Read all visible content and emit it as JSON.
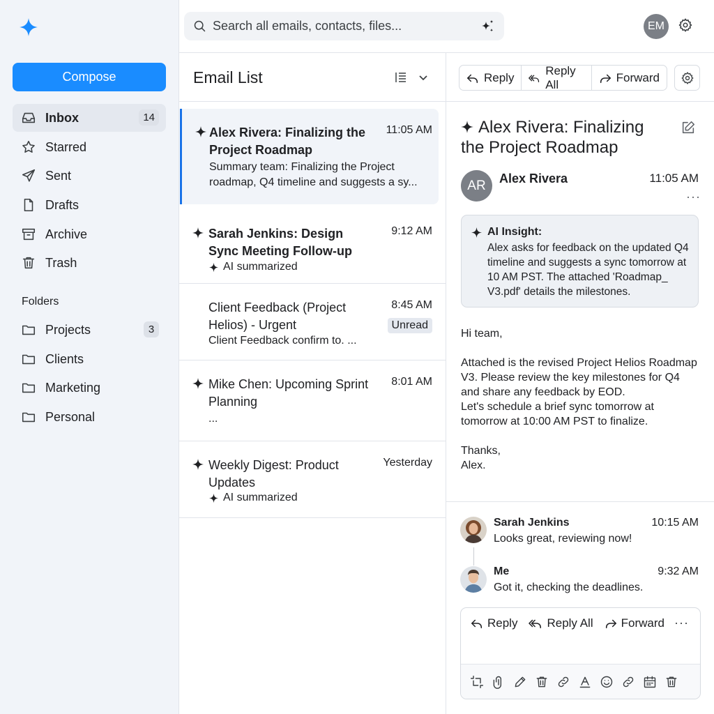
{
  "sidebar": {
    "compose_label": "Compose",
    "nav": [
      {
        "label": "Inbox",
        "count": "14",
        "icon": "inbox-icon"
      },
      {
        "label": "Starred",
        "icon": "star-icon"
      },
      {
        "label": "Sent",
        "icon": "send-icon"
      },
      {
        "label": "Drafts",
        "icon": "file-icon"
      },
      {
        "label": "Archive",
        "icon": "archive-icon"
      },
      {
        "label": "Trash",
        "icon": "trash-icon"
      }
    ],
    "folders_heading": "Folders",
    "folders": [
      {
        "label": "Projects",
        "count": "3"
      },
      {
        "label": "Clients"
      },
      {
        "label": "Marketing"
      },
      {
        "label": "Personal"
      }
    ]
  },
  "search": {
    "placeholder": "Search all emails, contacts, files..."
  },
  "user": {
    "initials": "EM"
  },
  "list": {
    "title": "Email List",
    "emails": [
      {
        "subject": "Alex Rivera: Finalizing the Project Roadmap",
        "time": "11:05 AM",
        "preview": "Summary team: Finalizing the Project roadmap, Q4 timeline and suggests a sy..."
      },
      {
        "subject": "Sarah Jenkins: Design Sync Meeting Follow-up",
        "time": "9:12 AM",
        "tag": "AI summarized"
      },
      {
        "subject": "Client Feedback (Project Helios) - Urgent",
        "time": "8:45 AM",
        "badge": "Unread",
        "preview": "Client Feedback confirm to. ..."
      },
      {
        "subject": "Mike Chen: Upcoming Sprint Planning",
        "time": "8:01 AM",
        "preview": "..."
      },
      {
        "subject": "Weekly Digest: Product Updates",
        "time": "Yesterday",
        "tag": "AI summarized"
      }
    ]
  },
  "pane": {
    "actions": {
      "reply": "Reply",
      "reply_all": "Reply All",
      "forward": "Forward"
    },
    "subject": "Alex Rivera: Finalizing the Project Roadmap",
    "sender_initials": "AR",
    "sender": "Alex Rivera",
    "time": "11:05 AM",
    "more": "···",
    "insight_label": "AI Insight:",
    "insight_text": "Alex asks for feedback on the updated Q4 timeline and suggests a sync tomorrow at 10 AM PST. The attached 'Roadmap_ V3.pdf' details the milestones.",
    "body": "Hi team,\n\nAttached is the revised Project Helios Roadmap V3. Please review the key milestones for Q4 and share any feedback by EOD.\nLet's schedule a brief sync tomorrow at tomorrow at 10:00 AM PST to finalize.\n\nThanks,\nAlex.",
    "thread": [
      {
        "name": "Sarah Jenkins",
        "time": "10:15 AM",
        "text": "Looks great, reviewing now!"
      },
      {
        "name": "Me",
        "time": "9:32 AM",
        "text": "Got it, checking the deadlines."
      }
    ],
    "composer": {
      "reply": "Reply",
      "reply_all": "Reply All",
      "forward": "Forward",
      "more": "···"
    }
  },
  "colors": {
    "accent": "#1a8cff",
    "sidebar_bg": "#f1f4f9",
    "selected_border": "#1a73e8"
  }
}
